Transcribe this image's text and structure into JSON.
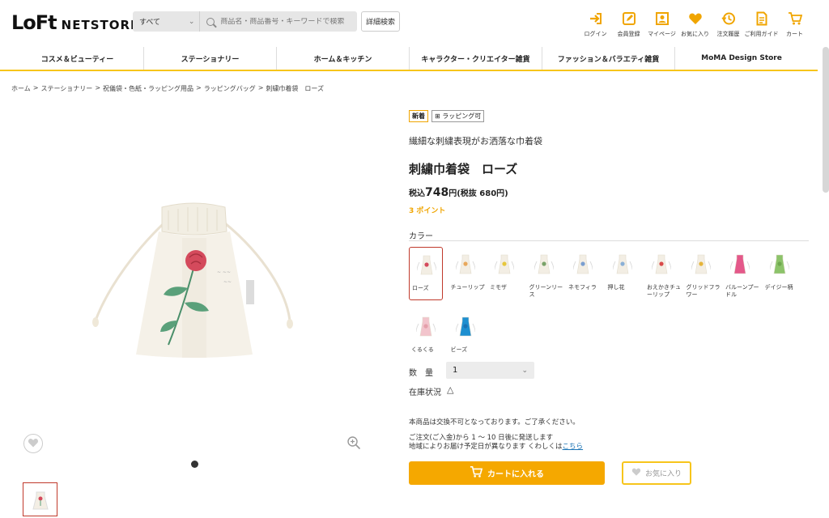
{
  "header": {
    "logo_mark": "LoFt",
    "logo_text": "NETSTORE",
    "search_category": "すべて",
    "search_placeholder": "商品名・商品番号・キーワードで検索",
    "advanced_search": "詳細検索",
    "icons": [
      {
        "label": "ログイン",
        "icon": "login-icon"
      },
      {
        "label": "会員登録",
        "icon": "register-icon"
      },
      {
        "label": "マイページ",
        "icon": "mypage-icon"
      },
      {
        "label": "お気に入り",
        "icon": "heart-icon"
      },
      {
        "label": "注文履歴",
        "icon": "history-icon"
      },
      {
        "label": "ご利用ガイド",
        "icon": "guide-icon"
      },
      {
        "label": "カート",
        "icon": "cart-icon"
      }
    ]
  },
  "nav": [
    "コスメ＆ビューティー",
    "ステーショナリー",
    "ホーム＆キッチン",
    "キャラクター・クリエイター雑貨",
    "ファッション＆バラエティ雑貨",
    "MoMA Design Store"
  ],
  "breadcrumb": [
    "ホーム",
    "ステーショナリー",
    "祝儀袋・色紙・ラッピング用品",
    "ラッピングバッグ",
    "刺繍巾着袋　ローズ"
  ],
  "product": {
    "badge_new": "新着",
    "badge_wrap": "ラッピング可",
    "subtitle": "繊細な刺繍表現がお洒落な巾着袋",
    "title": "刺繍巾着袋　ローズ",
    "price_prefix": "税込",
    "price_value": "748",
    "price_suffix": "円(税抜 680円)",
    "points": "3 ポイント",
    "color_label": "カラー",
    "colors": [
      {
        "name": "ローズ",
        "color": "#f3eee4",
        "accent": "#d44a5c",
        "selected": true
      },
      {
        "name": "チューリップ",
        "color": "#f3eee4",
        "accent": "#e8a85c"
      },
      {
        "name": "ミモザ",
        "color": "#f3eee4",
        "accent": "#e6c73c"
      },
      {
        "name": "グリーンリース",
        "color": "#f3eee4",
        "accent": "#7aa36a"
      },
      {
        "name": "ネモフィラ",
        "color": "#f3eee4",
        "accent": "#7b9fd0"
      },
      {
        "name": "押し花",
        "color": "#f3eee4",
        "accent": "#8bb0d6"
      },
      {
        "name": "おえかきチューリップ",
        "color": "#f3eee4",
        "accent": "#d94a4a"
      },
      {
        "name": "グリッドフラワー",
        "color": "#f3eee4",
        "accent": "#e5b43a"
      },
      {
        "name": "バルーンプードル",
        "color": "#e4588a",
        "accent": "#e4588a"
      },
      {
        "name": "デイジー柄",
        "color": "#8cc36a",
        "accent": "#6fa84e"
      },
      {
        "name": "くるくる",
        "color": "#f2c4cc",
        "accent": "#e4a0aa"
      },
      {
        "name": "ビーズ",
        "color": "#1e8fd0",
        "accent": "#1a73b5"
      }
    ],
    "qty_label": "数　量",
    "qty_value": "1",
    "stock_label": "在庫状況",
    "stock_icon": "△",
    "notice": "本商品は交換不可となっております。ご了承ください。",
    "ship_line1": "ご注文(ご入金)から 1 〜 10 日後に発送します",
    "ship_line2": "地域によりお届け予定日が異なります くわしくは",
    "ship_link": "こちら",
    "cart_button": "カートに入れる",
    "fav_button": "お気に入り"
  },
  "colors": {
    "accent": "#f5a800",
    "nav_border": "#f7c51b",
    "selected_border": "#c0392b",
    "link": "#1a73b5"
  }
}
